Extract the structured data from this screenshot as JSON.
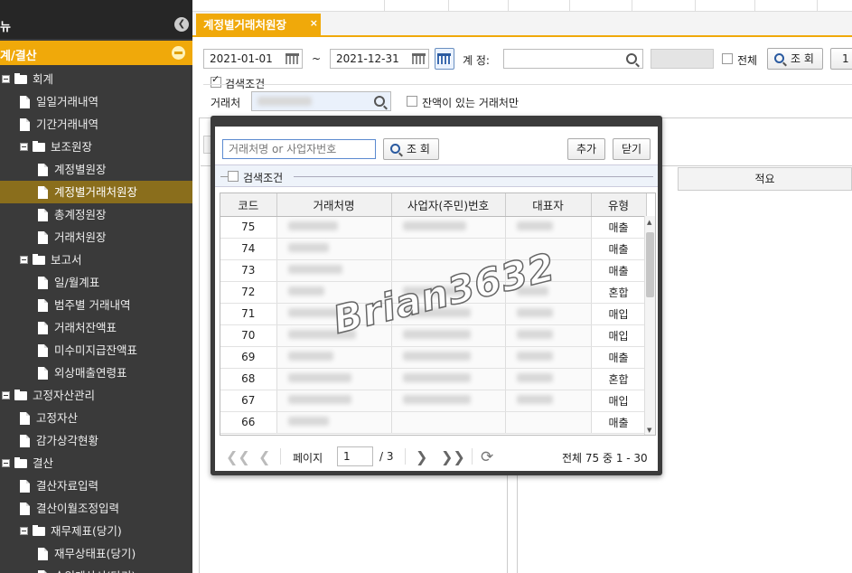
{
  "sidebar": {
    "header_title": "뉴",
    "category": "계/결산",
    "tree": [
      {
        "label": "회계",
        "level": 0,
        "kind": "folder"
      },
      {
        "label": "일일거래내역",
        "level": 1,
        "kind": "doc"
      },
      {
        "label": "기간거래내역",
        "level": 1,
        "kind": "doc"
      },
      {
        "label": "보조원장",
        "level": 1,
        "kind": "folder"
      },
      {
        "label": "계정별원장",
        "level": 2,
        "kind": "doc"
      },
      {
        "label": "계정별거래처원장",
        "level": 2,
        "kind": "doc",
        "selected": true
      },
      {
        "label": "총계정원장",
        "level": 2,
        "kind": "doc"
      },
      {
        "label": "거래처원장",
        "level": 2,
        "kind": "doc"
      },
      {
        "label": "보고서",
        "level": 1,
        "kind": "folder"
      },
      {
        "label": "일/월계표",
        "level": 2,
        "kind": "doc"
      },
      {
        "label": "범주별 거래내역",
        "level": 2,
        "kind": "doc"
      },
      {
        "label": "거래처잔액표",
        "level": 2,
        "kind": "doc"
      },
      {
        "label": "미수미지급잔액표",
        "level": 2,
        "kind": "doc"
      },
      {
        "label": "외상매출연령표",
        "level": 2,
        "kind": "doc"
      },
      {
        "label": "고정자산관리",
        "level": 0,
        "kind": "folder"
      },
      {
        "label": "고정자산",
        "level": 1,
        "kind": "doc"
      },
      {
        "label": "감가상각현황",
        "level": 1,
        "kind": "doc"
      },
      {
        "label": "결산",
        "level": 0,
        "kind": "folder"
      },
      {
        "label": "결산자료입력",
        "level": 1,
        "kind": "doc"
      },
      {
        "label": "결산이월조정입력",
        "level": 1,
        "kind": "doc"
      },
      {
        "label": "재무제표(당기)",
        "level": 1,
        "kind": "folder"
      },
      {
        "label": "재무상태표(당기)",
        "level": 2,
        "kind": "doc"
      },
      {
        "label": "손익계산서(당기)",
        "level": 2,
        "kind": "doc"
      }
    ]
  },
  "tabs": {
    "active": "계정별거래처원장",
    "close": "×"
  },
  "search": {
    "date_from": "2021-01-01",
    "tilde": "~",
    "date_to": "2021-12-31",
    "account_label": "계 정:",
    "all_label": "전체",
    "query_button": "조 회",
    "extra_button": "1",
    "cond_label": "검색조건",
    "client_label": "거래처",
    "balance_only_label": "잔액이 있는 거래처만"
  },
  "background_grid": {
    "memo_header": "적요"
  },
  "popup": {
    "search_placeholder": "거래처명 or 사업자번호",
    "query_button": "조 회",
    "add_button": "추가",
    "close_button": "닫기",
    "cond_label": "검색조건",
    "columns": [
      "코드",
      "거래처명",
      "사업자(주민)번호",
      "대표자",
      "유형"
    ],
    "rows": [
      {
        "code": "75",
        "type": "매출"
      },
      {
        "code": "74",
        "type": "매출"
      },
      {
        "code": "73",
        "type": "매출"
      },
      {
        "code": "72",
        "type": "혼합"
      },
      {
        "code": "71",
        "type": "매입"
      },
      {
        "code": "70",
        "type": "매입"
      },
      {
        "code": "69",
        "type": "매출"
      },
      {
        "code": "68",
        "type": "혼합"
      },
      {
        "code": "67",
        "type": "매입"
      },
      {
        "code": "66",
        "type": "매출"
      }
    ],
    "pager": {
      "page_label": "페이지",
      "page": "1",
      "total_pages": "/ 3",
      "summary": "전체 75 중 1 - 30"
    }
  },
  "watermark": "Brian3632",
  "colors": {
    "accent": "#f0a90a",
    "sidebar_bg": "#3a3a3a",
    "selected_bg": "#8a6e1c"
  }
}
